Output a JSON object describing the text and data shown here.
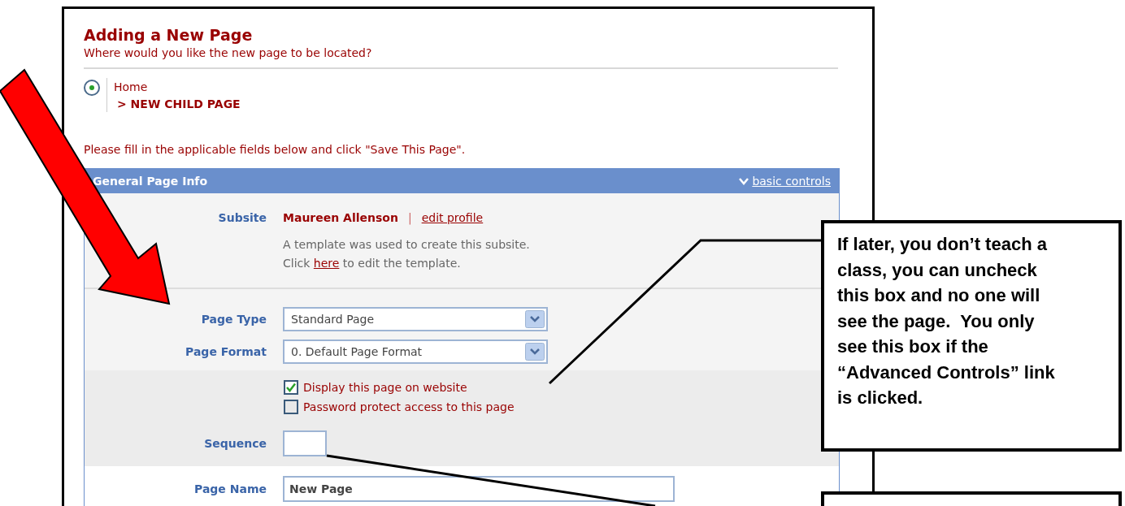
{
  "header": {
    "title": "Adding a New Page",
    "subtitle": "Where would you like the new page to be located?"
  },
  "location": {
    "radio_selected": true,
    "parent": "Home",
    "child": "> NEW CHILD PAGE"
  },
  "instruction": "Please fill in the applicable fields below and click \"Save This Page\".",
  "panel": {
    "title": "General Page Info",
    "toggle_link": "basic controls"
  },
  "subsite": {
    "label": "Subsite",
    "name": "Maureen Allenson",
    "separator": "|",
    "link": "edit profile",
    "note": "A template was used to create this subsite.",
    "note2": {
      "before": "Click",
      "link": "here",
      "after": "to edit the template."
    }
  },
  "selects": [
    {
      "label": "Page Type",
      "value": "Standard Page"
    },
    {
      "label": "Page Format",
      "value": "0. Default Page Format"
    }
  ],
  "checkboxes": [
    {
      "label": "Display this page on website",
      "checked": true
    },
    {
      "label": "Password protect access to this page",
      "checked": false
    }
  ],
  "sequence": {
    "label": "Sequence"
  },
  "page_name": {
    "label": "Page Name",
    "value": "New Page"
  },
  "callouts": [
    {
      "kind": "text",
      "lines": [
        "If later, you don’t teach a",
        "class, you can uncheck",
        "this box and no one will",
        "see the page.  You only",
        "see this box if the",
        "“Advanced Controls” link",
        "is clicked."
      ]
    },
    {
      "kind": "blank"
    }
  ]
}
